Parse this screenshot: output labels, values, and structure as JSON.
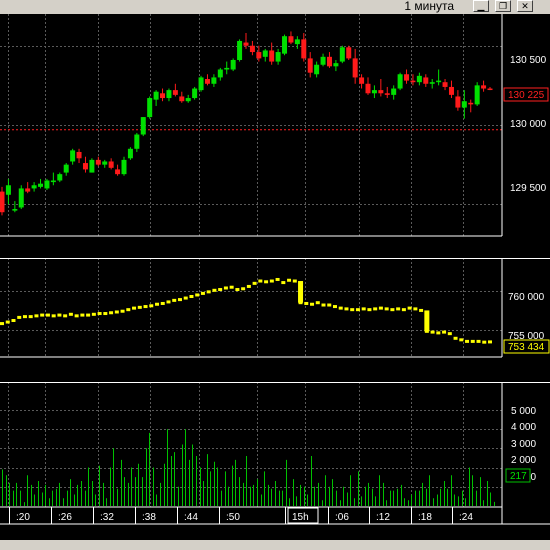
{
  "window": {
    "title": "1 минута",
    "buttons": [
      "minimize",
      "restore",
      "close"
    ]
  },
  "colors": {
    "background": "#000000",
    "grid": "#5a5a5a",
    "up_candle": "#00e000",
    "down_candle": "#ff1a1a",
    "close_line": "#ff2020",
    "volume_bar": "#00c000",
    "ticks_line": "#ffff00",
    "axis_text": "#ffffff"
  },
  "price_panel": {
    "y_labels": [
      "130 500",
      "130 000",
      "129 500"
    ],
    "current_value": "130 225",
    "previous_close": 129970
  },
  "ticks_panel": {
    "y_labels": [
      "760 000",
      "755 000"
    ],
    "current_value": "753 434"
  },
  "volume_panel": {
    "y_labels": [
      "5 000",
      "4 000",
      "3 000",
      "2 000",
      "1 000"
    ],
    "current_value": "217"
  },
  "time_axis": {
    "labels": [
      ":20",
      ":26",
      ":32",
      ":38",
      ":44",
      ":50",
      "15h",
      ":06",
      ":12",
      ":18",
      ":24"
    ],
    "highlighted_label": "15h"
  },
  "chart_data": [
    {
      "type": "candlestick",
      "title": "",
      "ylim": [
        129300,
        130700
      ],
      "candles": [
        [
          129580,
          129610,
          129430,
          129450
        ],
        [
          129560,
          129660,
          129500,
          129620
        ],
        [
          129460,
          129520,
          129450,
          129470
        ],
        [
          129480,
          129620,
          129470,
          129600
        ],
        [
          129600,
          129640,
          129570,
          129580
        ],
        [
          129600,
          129640,
          129580,
          129620
        ],
        [
          129610,
          129660,
          129600,
          129630
        ],
        [
          129600,
          129660,
          129590,
          129650
        ],
        [
          129640,
          129700,
          129620,
          129650
        ],
        [
          129650,
          129700,
          129640,
          129690
        ],
        [
          129700,
          129760,
          129680,
          129750
        ],
        [
          129770,
          129850,
          129750,
          129840
        ],
        [
          129830,
          129850,
          129760,
          129790
        ],
        [
          129760,
          129800,
          129700,
          129720
        ],
        [
          129700,
          129790,
          129700,
          129780
        ],
        [
          129780,
          129800,
          129740,
          129750
        ],
        [
          129750,
          129780,
          129730,
          129770
        ],
        [
          129770,
          129790,
          129720,
          129730
        ],
        [
          129720,
          129750,
          129680,
          129690
        ],
        [
          129690,
          129800,
          129680,
          129780
        ],
        [
          129790,
          129860,
          129780,
          129850
        ],
        [
          129850,
          129950,
          129830,
          129940
        ],
        [
          129940,
          130050,
          129930,
          130050
        ],
        [
          130050,
          130180,
          130040,
          130170
        ],
        [
          130160,
          130220,
          130120,
          130210
        ],
        [
          130200,
          130230,
          130150,
          130170
        ],
        [
          130170,
          130230,
          130150,
          130220
        ],
        [
          130220,
          130260,
          130180,
          130190
        ],
        [
          130180,
          130210,
          130140,
          130150
        ],
        [
          130150,
          130190,
          130140,
          130170
        ],
        [
          130170,
          130240,
          130160,
          130230
        ],
        [
          130220,
          130310,
          130210,
          130300
        ],
        [
          130290,
          130320,
          130250,
          130260
        ],
        [
          130260,
          130320,
          130240,
          130300
        ],
        [
          130300,
          130360,
          130280,
          130350
        ],
        [
          130350,
          130400,
          130320,
          130360
        ],
        [
          130350,
          130420,
          130340,
          130410
        ],
        [
          130410,
          130540,
          130400,
          130530
        ],
        [
          130520,
          130580,
          130480,
          130500
        ],
        [
          130500,
          130530,
          130440,
          130460
        ],
        [
          130460,
          130500,
          130400,
          130420
        ],
        [
          130430,
          130480,
          130400,
          130470
        ],
        [
          130470,
          130520,
          130380,
          130400
        ],
        [
          130400,
          130480,
          130380,
          130460
        ],
        [
          130450,
          130570,
          130440,
          130560
        ],
        [
          130560,
          130590,
          130510,
          130520
        ],
        [
          130510,
          130560,
          130480,
          130540
        ],
        [
          130540,
          130580,
          130400,
          130420
        ],
        [
          130420,
          130460,
          130300,
          130330
        ],
        [
          130320,
          130400,
          130300,
          130380
        ],
        [
          130380,
          130450,
          130370,
          130430
        ],
        [
          130430,
          130460,
          130360,
          130370
        ],
        [
          130370,
          130410,
          130340,
          130390
        ],
        [
          130400,
          130500,
          130390,
          130490
        ],
        [
          130490,
          130500,
          130410,
          130420
        ],
        [
          130420,
          130480,
          130260,
          130300
        ],
        [
          130300,
          130320,
          130230,
          130260
        ],
        [
          130260,
          130300,
          130190,
          130200
        ],
        [
          130200,
          130250,
          130170,
          130220
        ],
        [
          130220,
          130290,
          130180,
          130200
        ],
        [
          130200,
          130240,
          130170,
          130190
        ],
        [
          130190,
          130250,
          130160,
          130230
        ],
        [
          130230,
          130330,
          130220,
          130320
        ],
        [
          130320,
          130350,
          130260,
          130280
        ],
        [
          130280,
          130320,
          130250,
          130270
        ],
        [
          130270,
          130330,
          130250,
          130310
        ],
        [
          130300,
          130320,
          130240,
          130260
        ],
        [
          130260,
          130290,
          130230,
          130270
        ],
        [
          130270,
          130350,
          130250,
          130280
        ],
        [
          130270,
          130290,
          130220,
          130240
        ],
        [
          130240,
          130280,
          130170,
          130190
        ],
        [
          130180,
          130220,
          130090,
          130110
        ],
        [
          130110,
          130220,
          130040,
          130150
        ],
        [
          130140,
          130160,
          130080,
          130130
        ],
        [
          130130,
          130270,
          130120,
          130250
        ],
        [
          130250,
          130280,
          130210,
          130230
        ],
        [
          130230,
          130240,
          130220,
          130225
        ]
      ]
    },
    {
      "type": "line",
      "title": "",
      "ylim": [
        752000,
        763500
      ],
      "values": [
        755800,
        756000,
        756200,
        756600,
        756700,
        756700,
        756800,
        756900,
        756900,
        756800,
        756900,
        756800,
        757000,
        756800,
        756900,
        756900,
        757000,
        757100,
        757100,
        757200,
        757300,
        757400,
        757600,
        757800,
        757900,
        758000,
        758100,
        758300,
        758400,
        758600,
        758800,
        758900,
        759100,
        759300,
        759500,
        759700,
        759900,
        760100,
        760200,
        760400,
        760500,
        760200,
        760300,
        760600,
        761000,
        761300,
        761200,
        761300,
        761500,
        761100,
        761400,
        761300,
        758500,
        758400,
        758300,
        758500,
        758200,
        758200,
        758000,
        757800,
        757700,
        757600,
        757600,
        757700,
        757600,
        757700,
        757800,
        757700,
        757600,
        757700,
        757600,
        757800,
        757700,
        757500,
        754800,
        754700,
        754600,
        754700,
        754500,
        753900,
        753700,
        753500,
        753500,
        753500,
        753400,
        753434
      ]
    },
    {
      "type": "bar",
      "title": "",
      "ylim": [
        0,
        5200
      ],
      "values": [
        1900,
        1600,
        1200,
        800,
        1200,
        800,
        200,
        1600,
        1100,
        600,
        1300,
        700,
        1100,
        400,
        800,
        900,
        1200,
        400,
        800,
        1400,
        600,
        1100,
        1300,
        800,
        2000,
        1300,
        600,
        2100,
        1200,
        400,
        2000,
        3000,
        900,
        2400,
        1500,
        1200,
        2000,
        1500,
        2200,
        1500,
        3000,
        3800,
        2000,
        600,
        1200,
        2200,
        4000,
        2600,
        2800,
        1000,
        3200,
        4000,
        2400,
        3200,
        2600,
        2000,
        1300,
        2700,
        1800,
        2300,
        2000,
        800,
        1800,
        1000,
        2100,
        2400,
        1500,
        1200,
        2600,
        1000,
        1100,
        1400,
        600,
        1800,
        1100,
        900,
        1300,
        800,
        800,
        2400,
        400,
        1400,
        500,
        1100,
        1000,
        600,
        2600,
        1000,
        1200,
        300,
        1600,
        1000,
        1400,
        800,
        300,
        1000,
        700,
        1600,
        400,
        1800,
        500,
        1000,
        1200,
        900,
        500,
        1600,
        1200,
        300,
        800,
        800,
        900,
        1100,
        400,
        300,
        600,
        800,
        800,
        1200,
        900,
        1600,
        400,
        600,
        900,
        1300,
        900,
        1600,
        600,
        500,
        800,
        400,
        2000,
        1600,
        800,
        1500,
        300,
        1300,
        700,
        217
      ]
    }
  ]
}
